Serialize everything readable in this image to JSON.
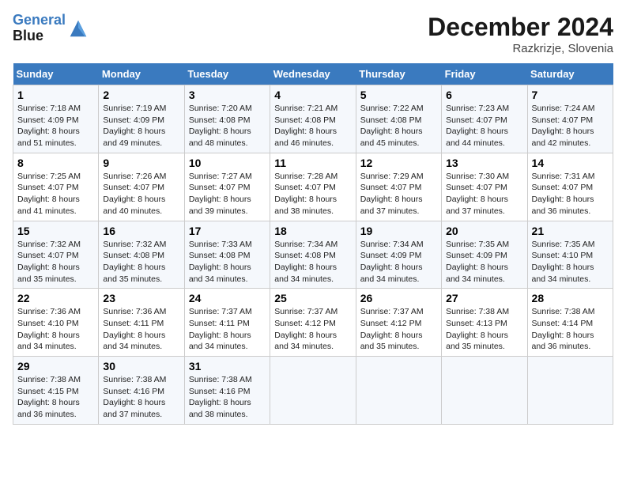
{
  "header": {
    "logo_line1": "General",
    "logo_line2": "Blue",
    "month_title": "December 2024",
    "location": "Razkrizje, Slovenia"
  },
  "days_of_week": [
    "Sunday",
    "Monday",
    "Tuesday",
    "Wednesday",
    "Thursday",
    "Friday",
    "Saturday"
  ],
  "weeks": [
    [
      {
        "day": "1",
        "lines": [
          "Sunrise: 7:18 AM",
          "Sunset: 4:09 PM",
          "Daylight: 8 hours",
          "and 51 minutes."
        ]
      },
      {
        "day": "2",
        "lines": [
          "Sunrise: 7:19 AM",
          "Sunset: 4:09 PM",
          "Daylight: 8 hours",
          "and 49 minutes."
        ]
      },
      {
        "day": "3",
        "lines": [
          "Sunrise: 7:20 AM",
          "Sunset: 4:08 PM",
          "Daylight: 8 hours",
          "and 48 minutes."
        ]
      },
      {
        "day": "4",
        "lines": [
          "Sunrise: 7:21 AM",
          "Sunset: 4:08 PM",
          "Daylight: 8 hours",
          "and 46 minutes."
        ]
      },
      {
        "day": "5",
        "lines": [
          "Sunrise: 7:22 AM",
          "Sunset: 4:08 PM",
          "Daylight: 8 hours",
          "and 45 minutes."
        ]
      },
      {
        "day": "6",
        "lines": [
          "Sunrise: 7:23 AM",
          "Sunset: 4:07 PM",
          "Daylight: 8 hours",
          "and 44 minutes."
        ]
      },
      {
        "day": "7",
        "lines": [
          "Sunrise: 7:24 AM",
          "Sunset: 4:07 PM",
          "Daylight: 8 hours",
          "and 42 minutes."
        ]
      }
    ],
    [
      {
        "day": "8",
        "lines": [
          "Sunrise: 7:25 AM",
          "Sunset: 4:07 PM",
          "Daylight: 8 hours",
          "and 41 minutes."
        ]
      },
      {
        "day": "9",
        "lines": [
          "Sunrise: 7:26 AM",
          "Sunset: 4:07 PM",
          "Daylight: 8 hours",
          "and 40 minutes."
        ]
      },
      {
        "day": "10",
        "lines": [
          "Sunrise: 7:27 AM",
          "Sunset: 4:07 PM",
          "Daylight: 8 hours",
          "and 39 minutes."
        ]
      },
      {
        "day": "11",
        "lines": [
          "Sunrise: 7:28 AM",
          "Sunset: 4:07 PM",
          "Daylight: 8 hours",
          "and 38 minutes."
        ]
      },
      {
        "day": "12",
        "lines": [
          "Sunrise: 7:29 AM",
          "Sunset: 4:07 PM",
          "Daylight: 8 hours",
          "and 37 minutes."
        ]
      },
      {
        "day": "13",
        "lines": [
          "Sunrise: 7:30 AM",
          "Sunset: 4:07 PM",
          "Daylight: 8 hours",
          "and 37 minutes."
        ]
      },
      {
        "day": "14",
        "lines": [
          "Sunrise: 7:31 AM",
          "Sunset: 4:07 PM",
          "Daylight: 8 hours",
          "and 36 minutes."
        ]
      }
    ],
    [
      {
        "day": "15",
        "lines": [
          "Sunrise: 7:32 AM",
          "Sunset: 4:07 PM",
          "Daylight: 8 hours",
          "and 35 minutes."
        ]
      },
      {
        "day": "16",
        "lines": [
          "Sunrise: 7:32 AM",
          "Sunset: 4:08 PM",
          "Daylight: 8 hours",
          "and 35 minutes."
        ]
      },
      {
        "day": "17",
        "lines": [
          "Sunrise: 7:33 AM",
          "Sunset: 4:08 PM",
          "Daylight: 8 hours",
          "and 34 minutes."
        ]
      },
      {
        "day": "18",
        "lines": [
          "Sunrise: 7:34 AM",
          "Sunset: 4:08 PM",
          "Daylight: 8 hours",
          "and 34 minutes."
        ]
      },
      {
        "day": "19",
        "lines": [
          "Sunrise: 7:34 AM",
          "Sunset: 4:09 PM",
          "Daylight: 8 hours",
          "and 34 minutes."
        ]
      },
      {
        "day": "20",
        "lines": [
          "Sunrise: 7:35 AM",
          "Sunset: 4:09 PM",
          "Daylight: 8 hours",
          "and 34 minutes."
        ]
      },
      {
        "day": "21",
        "lines": [
          "Sunrise: 7:35 AM",
          "Sunset: 4:10 PM",
          "Daylight: 8 hours",
          "and 34 minutes."
        ]
      }
    ],
    [
      {
        "day": "22",
        "lines": [
          "Sunrise: 7:36 AM",
          "Sunset: 4:10 PM",
          "Daylight: 8 hours",
          "and 34 minutes."
        ]
      },
      {
        "day": "23",
        "lines": [
          "Sunrise: 7:36 AM",
          "Sunset: 4:11 PM",
          "Daylight: 8 hours",
          "and 34 minutes."
        ]
      },
      {
        "day": "24",
        "lines": [
          "Sunrise: 7:37 AM",
          "Sunset: 4:11 PM",
          "Daylight: 8 hours",
          "and 34 minutes."
        ]
      },
      {
        "day": "25",
        "lines": [
          "Sunrise: 7:37 AM",
          "Sunset: 4:12 PM",
          "Daylight: 8 hours",
          "and 34 minutes."
        ]
      },
      {
        "day": "26",
        "lines": [
          "Sunrise: 7:37 AM",
          "Sunset: 4:12 PM",
          "Daylight: 8 hours",
          "and 35 minutes."
        ]
      },
      {
        "day": "27",
        "lines": [
          "Sunrise: 7:38 AM",
          "Sunset: 4:13 PM",
          "Daylight: 8 hours",
          "and 35 minutes."
        ]
      },
      {
        "day": "28",
        "lines": [
          "Sunrise: 7:38 AM",
          "Sunset: 4:14 PM",
          "Daylight: 8 hours",
          "and 36 minutes."
        ]
      }
    ],
    [
      {
        "day": "29",
        "lines": [
          "Sunrise: 7:38 AM",
          "Sunset: 4:15 PM",
          "Daylight: 8 hours",
          "and 36 minutes."
        ]
      },
      {
        "day": "30",
        "lines": [
          "Sunrise: 7:38 AM",
          "Sunset: 4:16 PM",
          "Daylight: 8 hours",
          "and 37 minutes."
        ]
      },
      {
        "day": "31",
        "lines": [
          "Sunrise: 7:38 AM",
          "Sunset: 4:16 PM",
          "Daylight: 8 hours",
          "and 38 minutes."
        ]
      },
      null,
      null,
      null,
      null
    ]
  ]
}
